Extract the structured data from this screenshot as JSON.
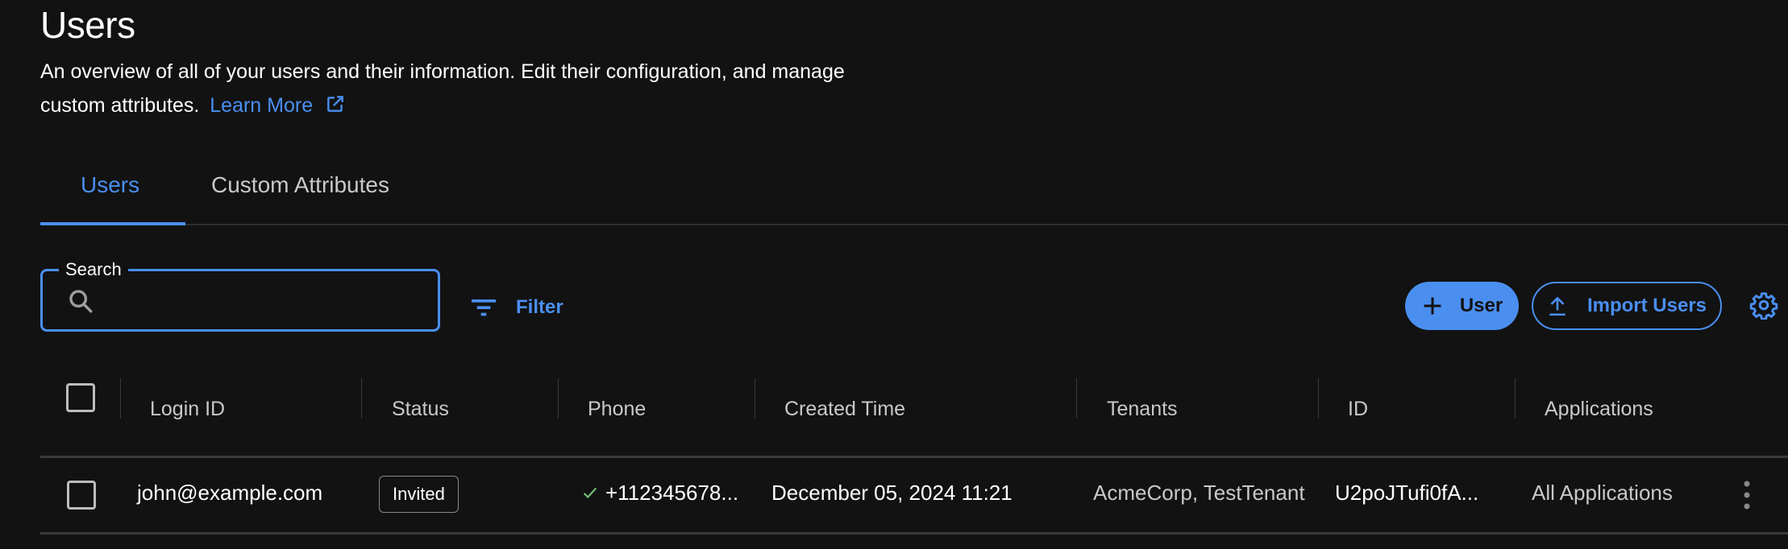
{
  "header": {
    "title": "Users",
    "description": "An overview of all of your users and their information. Edit their configuration, and manage custom attributes.",
    "learn_more": "Learn More"
  },
  "tabs": [
    {
      "label": "Users",
      "active": true
    },
    {
      "label": "Custom Attributes",
      "active": false
    }
  ],
  "toolbar": {
    "search_label": "Search",
    "search_value": "",
    "search_placeholder": "",
    "filter_label": "Filter",
    "add_user_label": "User",
    "import_label": "Import Users"
  },
  "table": {
    "columns": [
      "Login ID",
      "Status",
      "Phone",
      "Created Time",
      "Tenants",
      "ID",
      "Applications"
    ],
    "rows": [
      {
        "login_id": "john@example.com",
        "status": "Invited",
        "phone": "+112345678...",
        "phone_verified": true,
        "created_time": "December 05, 2024 11:21",
        "tenants": "AcmeCorp, TestTenant",
        "id": "U2poJTufi0fA...",
        "applications": "All Applications"
      }
    ]
  },
  "colors": {
    "accent": "#4a8ff0",
    "background": "#121212",
    "verified": "#6fbf73"
  }
}
